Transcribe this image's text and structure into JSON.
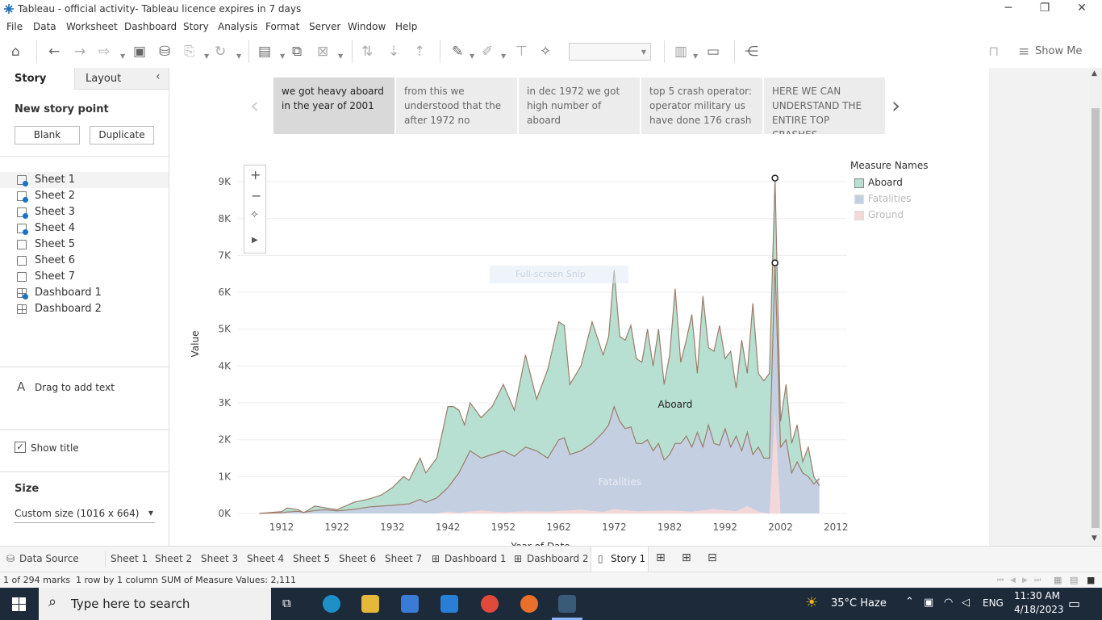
{
  "window": {
    "title": "Tableau - official activity- Tableau licence expires in 7 days"
  },
  "menu": [
    "File",
    "Data",
    "Worksheet",
    "Dashboard",
    "Story",
    "Analysis",
    "Format",
    "Server",
    "Window",
    "Help"
  ],
  "toolbar": {
    "show_me": "Show Me"
  },
  "left_panel": {
    "tabs": [
      "Story",
      "Layout"
    ],
    "new_story_point": "New story point",
    "blank_button": "Blank",
    "duplicate_button": "Duplicate",
    "sheets": [
      {
        "label": "Sheet 1",
        "used": true,
        "type": "sheet"
      },
      {
        "label": "Sheet 2",
        "used": true,
        "type": "sheet"
      },
      {
        "label": "Sheet 3",
        "used": true,
        "type": "sheet"
      },
      {
        "label": "Sheet 4",
        "used": true,
        "type": "sheet"
      },
      {
        "label": "Sheet 5",
        "used": false,
        "type": "sheet"
      },
      {
        "label": "Sheet 6",
        "used": false,
        "type": "sheet"
      },
      {
        "label": "Sheet 7",
        "used": false,
        "type": "sheet"
      },
      {
        "label": "Dashboard 1",
        "used": true,
        "type": "dashboard"
      },
      {
        "label": "Dashboard 2",
        "used": false,
        "type": "dashboard"
      }
    ],
    "drag_text": "Drag to add text",
    "show_title": "Show title",
    "size_label": "Size",
    "size_value": "Custom size (1016 x 664)"
  },
  "story_points": [
    "we got heavy aboard in the year of 2001",
    "from this we understood that the after 1972 no",
    "in dec 1972 we got high number of aboard",
    "top 5 crash operator: operator military us have done 176 crash",
    "HERE WE CAN UNDERSTAND THE ENTIRE TOP CRASHES"
  ],
  "snip_overlay": "Full-screen Snip",
  "legend": {
    "title": "Measure Names",
    "items": [
      {
        "label": "Aboard",
        "color": "#b8e0d2",
        "dim": false
      },
      {
        "label": "Fatalities",
        "color": "#c5cfe2",
        "dim": true
      },
      {
        "label": "Ground",
        "color": "#f4d7d9",
        "dim": true
      }
    ]
  },
  "chart_data": {
    "type": "area",
    "xlabel": "Year of Date",
    "ylabel": "Value",
    "ylim": [
      0,
      9200
    ],
    "xlim": [
      1904,
      2014
    ],
    "x_ticks": [
      1912,
      1922,
      1932,
      1942,
      1952,
      1962,
      1972,
      1982,
      1992,
      2002,
      2012
    ],
    "y_ticks": [
      "0K",
      "1K",
      "2K",
      "3K",
      "4K",
      "5K",
      "6K",
      "7K",
      "8K",
      "9K"
    ],
    "annotations": [
      "Aboard",
      "Fatalities"
    ],
    "series": [
      {
        "name": "Fatalities",
        "color": "#c5cfe2",
        "x": [
          1908,
          1912,
          1913,
          1915,
          1916,
          1918,
          1920,
          1922,
          1925,
          1928,
          1930,
          1932,
          1934,
          1935,
          1936,
          1937,
          1938,
          1940,
          1942,
          1943,
          1944,
          1945,
          1946,
          1948,
          1950,
          1952,
          1954,
          1956,
          1958,
          1960,
          1962,
          1963,
          1964,
          1966,
          1968,
          1970,
          1971,
          1972,
          1973,
          1974,
          1975,
          1976,
          1977,
          1978,
          1979,
          1980,
          1981,
          1982,
          1983,
          1984,
          1985,
          1986,
          1987,
          1988,
          1989,
          1990,
          1991,
          1992,
          1993,
          1994,
          1995,
          1996,
          1997,
          1998,
          1999,
          2000,
          2001,
          2002,
          2003,
          2004,
          2005,
          2006,
          2007,
          2008,
          2009
        ],
        "y": [
          0,
          20,
          40,
          60,
          30,
          80,
          100,
          70,
          110,
          180,
          200,
          220,
          250,
          260,
          320,
          380,
          300,
          420,
          700,
          900,
          1100,
          1400,
          1700,
          1500,
          1600,
          1700,
          1550,
          1800,
          1700,
          1500,
          2000,
          2050,
          1600,
          1700,
          1900,
          2200,
          2400,
          2900,
          2500,
          2300,
          2350,
          1900,
          1900,
          2000,
          1700,
          1900,
          1450,
          1600,
          1900,
          1900,
          2100,
          1800,
          2200,
          1800,
          2400,
          1900,
          1850,
          2300,
          1800,
          2100,
          1700,
          2200,
          1600,
          1800,
          1500,
          1500,
          6800,
          1800,
          2000,
          1100,
          1400,
          1100,
          1000,
          800,
          950
        ]
      },
      {
        "name": "Aboard",
        "color": "#b8e0d2",
        "x": [
          1908,
          1912,
          1913,
          1915,
          1916,
          1918,
          1920,
          1922,
          1925,
          1928,
          1930,
          1932,
          1934,
          1935,
          1936,
          1937,
          1938,
          1940,
          1942,
          1943,
          1944,
          1945,
          1946,
          1948,
          1950,
          1952,
          1954,
          1956,
          1958,
          1960,
          1962,
          1963,
          1964,
          1966,
          1968,
          1970,
          1971,
          1972,
          1973,
          1974,
          1975,
          1976,
          1977,
          1978,
          1979,
          1980,
          1981,
          1982,
          1983,
          1984,
          1985,
          1986,
          1987,
          1988,
          1989,
          1990,
          1991,
          1992,
          1993,
          1994,
          1995,
          1996,
          1997,
          1998,
          1999,
          2000,
          2001,
          2002,
          2003,
          2004,
          2005,
          2006,
          2007,
          2008,
          2009
        ],
        "y": [
          0,
          50,
          150,
          100,
          20,
          200,
          150,
          100,
          300,
          400,
          500,
          700,
          1000,
          900,
          1200,
          1500,
          1100,
          1500,
          2900,
          2900,
          2800,
          2400,
          3000,
          2600,
          2900,
          3500,
          2800,
          4300,
          3100,
          3900,
          5200,
          5100,
          3500,
          4000,
          5200,
          4300,
          4800,
          6600,
          4800,
          4700,
          5100,
          4200,
          4100,
          5000,
          4000,
          5000,
          3500,
          4300,
          6100,
          4100,
          4700,
          5400,
          3800,
          5900,
          4500,
          4400,
          5100,
          4200,
          4400,
          3400,
          4700,
          3800,
          5700,
          3800,
          3600,
          3800,
          9100,
          2500,
          3500,
          1900,
          2400,
          1400,
          1800,
          1000,
          750
        ]
      },
      {
        "name": "Ground",
        "color": "#f4d7d9",
        "x": [
          1908,
          1940,
          1942,
          1944,
          1948,
          1952,
          1956,
          1960,
          1966,
          1970,
          1972,
          1976,
          1982,
          1986,
          1990,
          1994,
          1996,
          1998,
          2000,
          2001,
          2002,
          2004,
          2009
        ],
        "y": [
          0,
          0,
          50,
          20,
          80,
          30,
          60,
          50,
          100,
          40,
          120,
          60,
          80,
          50,
          120,
          60,
          200,
          50,
          0,
          2800,
          0,
          0,
          0
        ]
      }
    ]
  },
  "tabs": [
    "Data Source",
    "Sheet 1",
    "Sheet 2",
    "Sheet 3",
    "Sheet 4",
    "Sheet 5",
    "Sheet 6",
    "Sheet 7",
    "Dashboard 1",
    "Dashboard 2",
    "Story 1"
  ],
  "status": {
    "marks": "1 of 294 marks",
    "rows": "1 row by 1 column",
    "sum": "SUM of Measure Values: 2,111"
  },
  "taskbar": {
    "search_placeholder": "Type here to search",
    "weather": "35°C  Haze",
    "lang": "ENG",
    "time": "11:30 AM",
    "date": "4/18/2023"
  }
}
